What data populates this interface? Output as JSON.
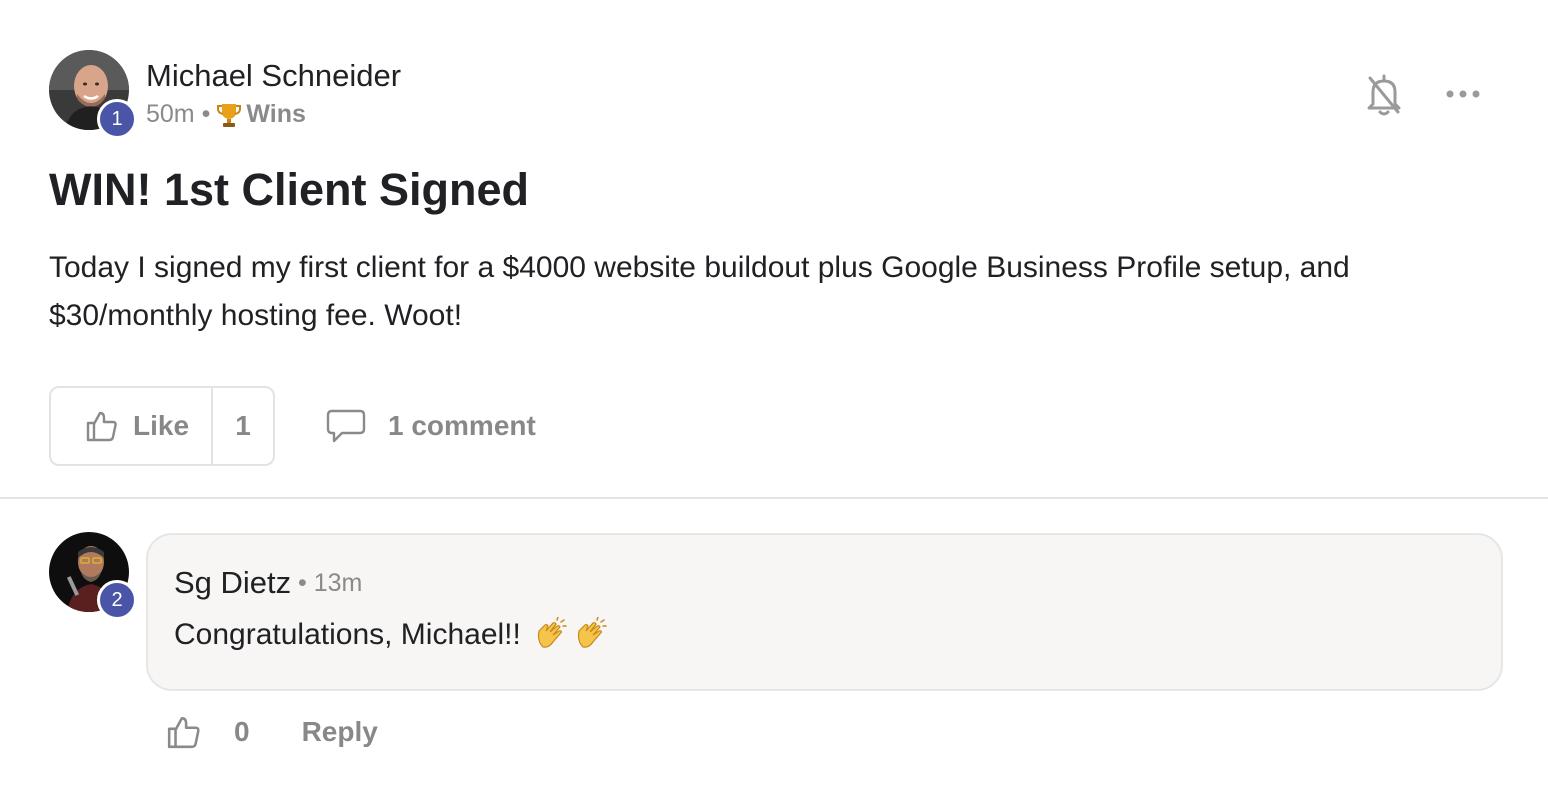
{
  "post": {
    "author": {
      "name": "Michael Schneider",
      "level": "1"
    },
    "time": "50m",
    "separator": "•",
    "category": "Wins",
    "category_icon": "trophy-icon",
    "title": "WIN! 1st Client Signed",
    "body": "Today I signed my first client for a $4000 website buildout plus Google Business Profile setup, and $30/monthly hosting fee. Woot!",
    "actions": {
      "like_label": "Like",
      "like_count": "1",
      "comment_label": "1 comment",
      "notification_icon": "bell-off-icon",
      "more_icon": "more-horizontal-icon"
    }
  },
  "comments": [
    {
      "author": "Sg Dietz",
      "level": "2",
      "time": "• 13m",
      "text": "Congratulations, Michael!!",
      "emoji": [
        "clapping-hands",
        "clapping-hands"
      ],
      "like_count": "0",
      "reply_label": "Reply"
    }
  ],
  "colors": {
    "level_badge": "#4a55a8",
    "muted_text": "#8a8a8a",
    "comment_bubble": "#f7f6f5",
    "border": "#e3e3e3"
  }
}
